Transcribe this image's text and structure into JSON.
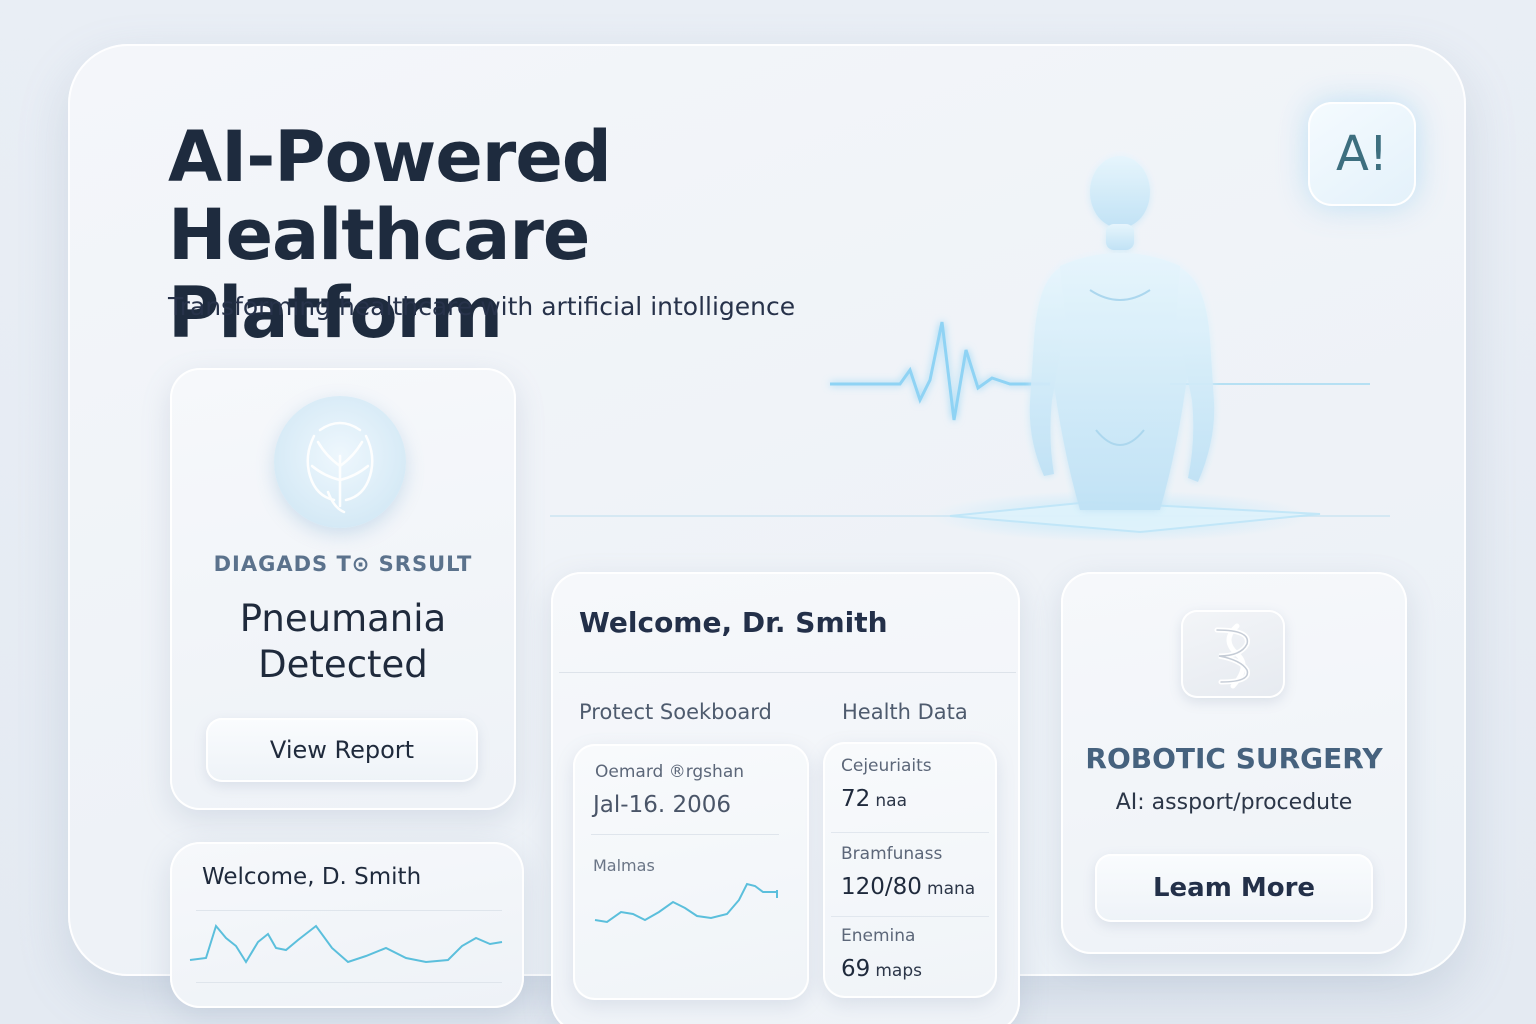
{
  "hero": {
    "title_line1": "AI-Powered",
    "title_line2": "Healthcare Platform",
    "subtitle": "Transforming healthcare with artificial intolligence",
    "badge": "A!"
  },
  "diagnosis_card": {
    "label": "DIAGADS T⊙ SRSULT",
    "result_line1": "Pneumania",
    "result_line2": "Detected",
    "button": "View Report",
    "icon": "lung-icon"
  },
  "welcome_small": {
    "title": "Welcome, D. Smith"
  },
  "dashboard": {
    "title": "Welcome, Dr. Smith",
    "left_column_label": "Protect Soekboard",
    "right_column_label": "Health Data",
    "appointment": {
      "label": "Oemard  ®rgshan",
      "date": "Jal-16. 2006",
      "metric": "Malmas"
    },
    "health_data": [
      {
        "label": "Cejeuriaits",
        "value": "72",
        "unit": "naa"
      },
      {
        "label": "Bramfunass",
        "value": "120/80",
        "unit": "mana"
      },
      {
        "label": "Enemina",
        "value": "69",
        "unit": "maps"
      }
    ]
  },
  "robotic_card": {
    "title": "ROBOTIC SURGERY",
    "subtitle": "AI: assport/procedute",
    "button": "Leam More",
    "icon": "dna-icon"
  },
  "colors": {
    "background": "#e9eef5",
    "heading": "#1e2b3e",
    "accent_glow": "#8fd3f4",
    "muted_heading": "#46627e"
  }
}
